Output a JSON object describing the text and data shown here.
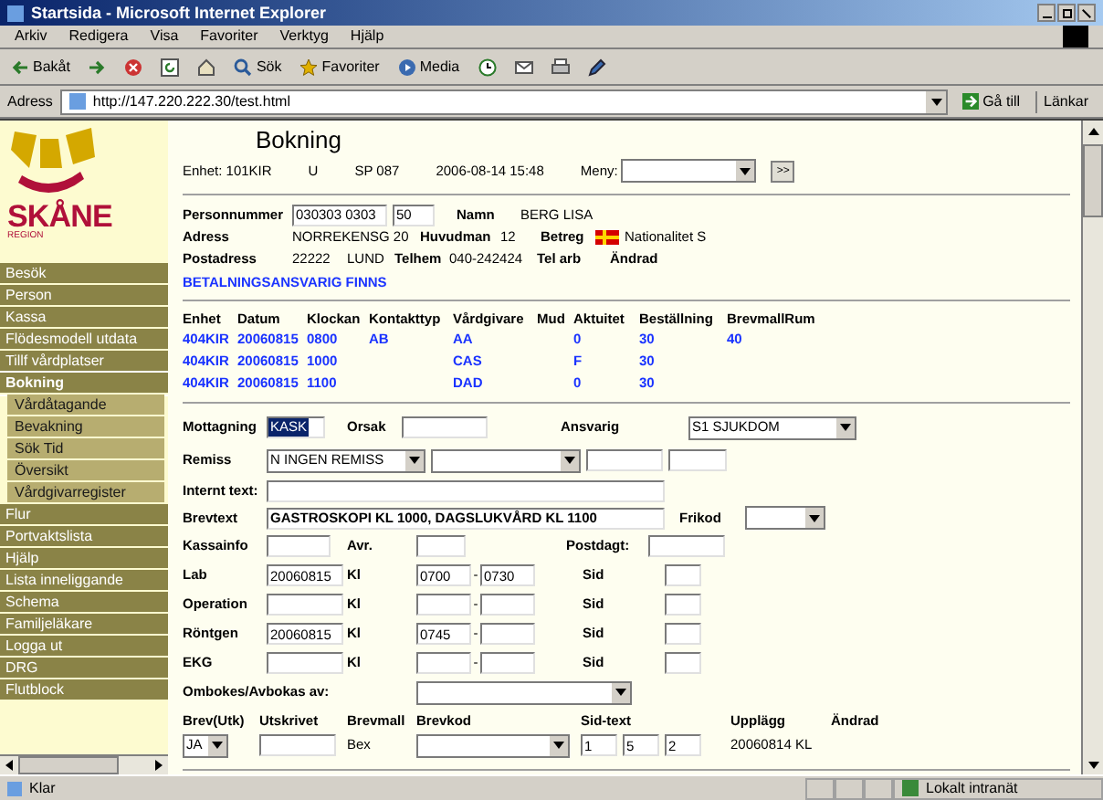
{
  "window": {
    "title": "Startsida - Microsoft Internet Explorer"
  },
  "menu": [
    "Arkiv",
    "Redigera",
    "Visa",
    "Favoriter",
    "Verktyg",
    "Hjälp"
  ],
  "toolbar": [
    {
      "kind": "back",
      "label": "Bakåt"
    },
    {
      "kind": "forward"
    },
    {
      "kind": "stop"
    },
    {
      "kind": "refresh"
    },
    {
      "kind": "home"
    },
    {
      "kind": "search",
      "label": "Sök"
    },
    {
      "kind": "favorites",
      "label": "Favoriter"
    },
    {
      "kind": "media",
      "label": "Media"
    },
    {
      "kind": "history"
    },
    {
      "kind": "mail"
    },
    {
      "kind": "print"
    },
    {
      "kind": "edit"
    }
  ],
  "address_bar": {
    "label": "Adress",
    "value": "http://147.220.222.30/test.html",
    "go": "Gå till",
    "links": "Länkar"
  },
  "sidebar": {
    "logo": {
      "small": "REGION",
      "name": "SKÅNE"
    },
    "items": [
      {
        "label": "Besök",
        "sub": false,
        "selected": false
      },
      {
        "label": "Person",
        "sub": false,
        "selected": false
      },
      {
        "label": "Kassa",
        "sub": false,
        "selected": false
      },
      {
        "label": "Flödesmodell utdata",
        "sub": false,
        "selected": false
      },
      {
        "label": "Tillf vårdplatser",
        "sub": false,
        "selected": false
      },
      {
        "label": "Bokning",
        "sub": false,
        "selected": true
      },
      {
        "label": "Vårdåtagande",
        "sub": true,
        "selected": false
      },
      {
        "label": "Bevakning",
        "sub": true,
        "selected": false
      },
      {
        "label": "Sök Tid",
        "sub": true,
        "selected": false
      },
      {
        "label": "Översikt",
        "sub": true,
        "selected": false
      },
      {
        "label": "Vårdgivarregister",
        "sub": true,
        "selected": false
      },
      {
        "label": "Flur",
        "sub": false,
        "selected": false
      },
      {
        "label": "Portvaktslista",
        "sub": false,
        "selected": false
      },
      {
        "label": "Hjälp",
        "sub": false,
        "selected": false
      },
      {
        "label": "Lista inneliggande",
        "sub": false,
        "selected": false
      },
      {
        "label": "Schema",
        "sub": false,
        "selected": false
      },
      {
        "label": "Familjeläkare",
        "sub": false,
        "selected": false
      },
      {
        "label": "Logga ut",
        "sub": false,
        "selected": false
      },
      {
        "label": "DRG",
        "sub": false,
        "selected": false
      },
      {
        "label": "Flutblock",
        "sub": false,
        "selected": false
      }
    ]
  },
  "page": {
    "heading": "Bokning",
    "unit": "Enhet: 101KIR",
    "code1": "U",
    "code2": "SP 087",
    "timestamp": "2006-08-14 15:48",
    "menu_label": "Meny:",
    "go_button": ">>"
  },
  "patient": {
    "pnr_label": "Personnummer",
    "pnr": "030303 0303",
    "age": "50",
    "name_label": "Namn",
    "name": "BERG LISA",
    "address_label": "Adress",
    "address": "NORREKENSG 20",
    "huvudman_label": "Huvudman",
    "huvudman": "12",
    "betreg_label": "Betreg",
    "nationality": "Nationalitet S",
    "postal_label": "Postadress",
    "postal_code": "22222",
    "city": "LUND",
    "telhem_label": "Telhem",
    "telhem": "040-242424",
    "telarb_label": "Tel arb",
    "changed_label": "Ändrad",
    "payment_notice": "BETALNINGSANSVARIG FINNS"
  },
  "bookings": {
    "columns": [
      "Enhet",
      "Datum",
      "Klockan",
      "Kontakttyp",
      "Vårdgivare",
      "Mud",
      "Aktuitet",
      "Beställning",
      "BrevmallRum"
    ],
    "rows": [
      [
        "404KIR",
        "20060815",
        "0800",
        "AB",
        "AA",
        null,
        "0",
        "30",
        "40"
      ],
      [
        "404KIR",
        "20060815",
        "1000",
        null,
        "CAS",
        null,
        "F",
        "30",
        null
      ],
      [
        "404KIR",
        "20060815",
        "1100",
        null,
        "DAD",
        null,
        "0",
        "30",
        null
      ]
    ]
  },
  "form": {
    "mottagning_label": "Mottagning",
    "mottagning": "KASK",
    "orsak_label": "Orsak",
    "ansvarig_label": "Ansvarig",
    "ansvarig": "S1 SJUKDOM",
    "remiss_label": "Remiss",
    "remiss": "N INGEN REMISS",
    "internal_label": "Internt text:",
    "letter_label": "Brevtext",
    "letter": "GASTROSKOPI KL 1000, DAGSLUKVÅRD KL 1100",
    "frikod_label": "Frikod",
    "kassa_label": "Kassainfo",
    "avr_label": "Avr.",
    "postdag_label": "Postdagt:"
  },
  "appointments": [
    {
      "label": "Lab",
      "date": "20060815",
      "kl_label": "Kl",
      "from": "0700",
      "separator": "-",
      "to": "0730",
      "sid_label": "Sid"
    },
    {
      "label": "Operation",
      "kl_label": "Kl",
      "separator": "-",
      "sid_label": "Sid"
    },
    {
      "label": "Röntgen",
      "date": "20060815",
      "kl_label": "Kl",
      "from": "0745",
      "separator": "-",
      "sid_label": "Sid"
    },
    {
      "label": "EKG",
      "kl_label": "Kl",
      "separator": "-",
      "sid_label": "Sid"
    }
  ],
  "rebook": {
    "label": "Ombokes/Avbokas av:"
  },
  "letter": {
    "columns": [
      "Brev(Utk)",
      "Utskrivet",
      "Brevmall",
      "Brevkod",
      "Sid-text",
      "Upplägg",
      "Ändrad"
    ],
    "brev": "JA",
    "brevmall": "Bex",
    "sid_texts": [
      "1",
      "5",
      "2"
    ],
    "created": "20060814 KL"
  },
  "status_bar": {
    "text": "Klar",
    "zone": "Lokalt intranät"
  }
}
